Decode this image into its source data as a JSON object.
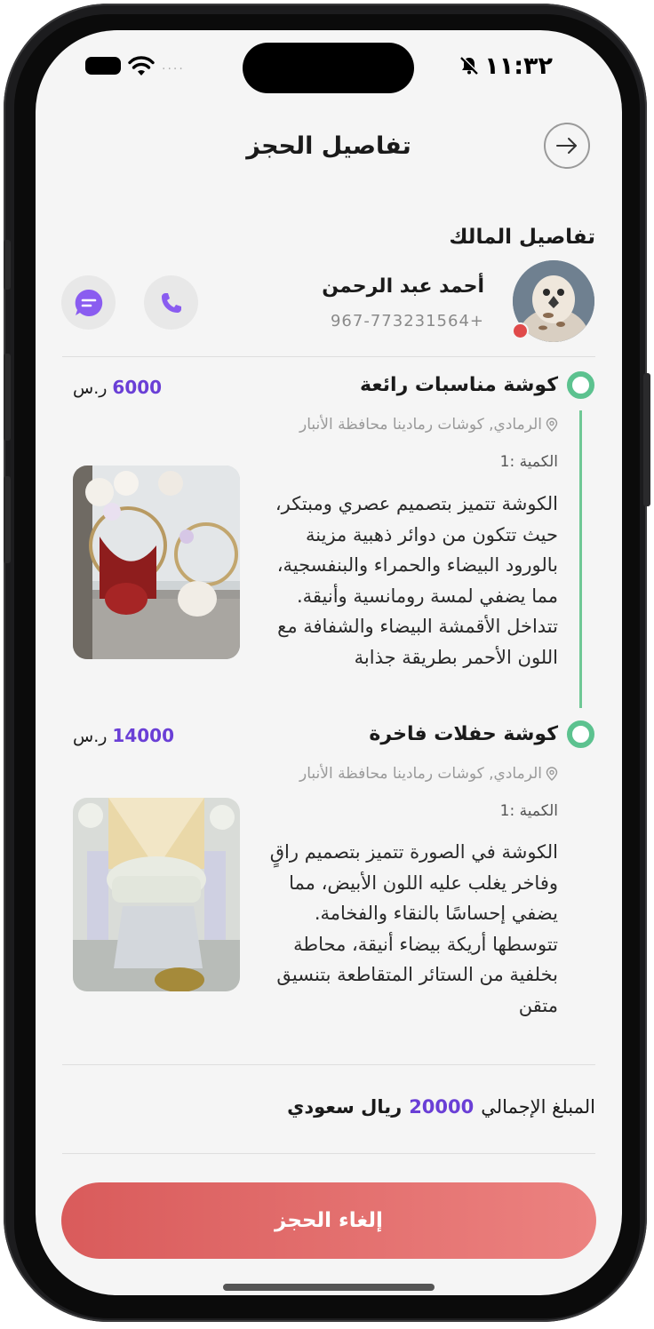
{
  "status_bar": {
    "time": "١١:٣٢",
    "signal_dots": "....",
    "icons": [
      "battery-icon",
      "wifi-icon",
      "bell-muted-icon"
    ]
  },
  "header": {
    "title": "تفاصيل الحجز",
    "back_icon": "arrow-right-icon"
  },
  "owner": {
    "section_title": "تفاصيل المالك",
    "name": "أحمد عبد الرحمن",
    "phone": "967-773231564+",
    "call_icon": "phone-icon",
    "chat_icon": "chat-icon"
  },
  "items": [
    {
      "title": "كوشة مناسبات رائعة",
      "price": "6000",
      "currency": "ر.س",
      "location": "الرمادي, كوشات رمادينا محافظة الأنبار",
      "quantity": "الكمية :1",
      "description": "الكوشة تتميز بتصميم عصري ومبتكر، حيث تتكون من دوائر ذهبية مزينة بالورود البيضاء والحمراء والبنفسجية، مما يضفي لمسة رومانسية وأنيقة. تتداخل الأقمشة البيضاء والشفافة مع اللون الأحمر بطريقة جذابة"
    },
    {
      "title": "كوشة حفلات فاخرة",
      "price": "14000",
      "currency": "ر.س",
      "location": "الرمادي, كوشات رمادينا محافظة الأنبار",
      "quantity": "الكمية :1",
      "description": "الكوشة في الصورة تتميز بتصميم راقٍ وفاخر يغلب عليه اللون الأبيض، مما يضفي إحساسًا بالنقاء والفخامة. تتوسطها أريكة بيضاء أنيقة، محاطة بخلفية من الستائر المتقاطعة بتنسيق متقن"
    }
  ],
  "total": {
    "label": "المبلغ الإجمالي",
    "value": "20000",
    "currency": "ريال سعودي"
  },
  "cancel_button": {
    "label": "إلغاء الحجز"
  },
  "colors": {
    "accent": "#6a3fd6",
    "timeline": "#5cc28f",
    "danger_start": "#d95b5b",
    "danger_end": "#ec8280"
  }
}
